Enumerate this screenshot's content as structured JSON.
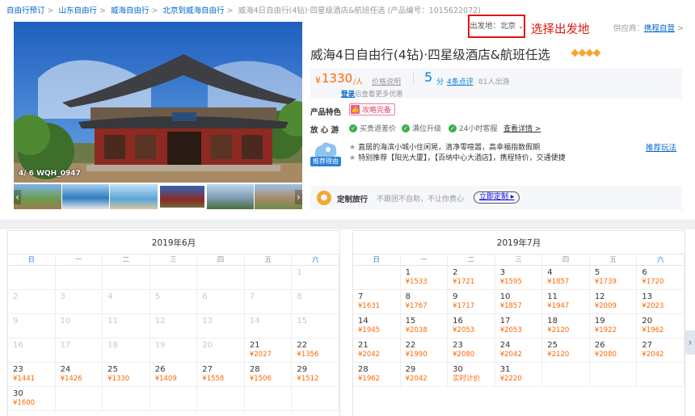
{
  "breadcrumb": [
    "自由行预订",
    "山东自由行",
    "威海自由行",
    "北京到威海自由行",
    "威海4日自由行(4钻)·四星级酒店&航班任选 (产品编号：1015622072)"
  ],
  "gallery": {
    "counter": "4/ 6 WQH_0947"
  },
  "depart": {
    "label": "出发地：北京"
  },
  "annotation": "选择出发地",
  "supplier": {
    "prefix": "供应商：",
    "name": "携程自营"
  },
  "product": {
    "title": "威海4日自由行(4钻)·四星级酒店&航班任选"
  },
  "price": {
    "currency": "¥",
    "value": "1330",
    "unit": "/人",
    "explain": "价格说明",
    "score": "5",
    "score_unit": "分",
    "reviews": "4条点评",
    "trips": "81人出游",
    "login": "登录",
    "login_hint": "后查看更多优惠"
  },
  "feature": {
    "label": "产品特色",
    "tag": "攻略完备"
  },
  "assurance": {
    "label": "放 心 游",
    "items": [
      "买贵退差价",
      "满位升级",
      "24小时客服"
    ],
    "more": "查看详情"
  },
  "reason": {
    "badge": "推荐理由",
    "lines": [
      "直居的海滨小城小住闲晃，清净零喧嚣，高幸福指数假期",
      "特别推荐【阳光大厦】，【百纳中心大酒店】，携程特价，交通便捷"
    ],
    "link": "推荐玩法"
  },
  "custom": {
    "title": "定制旅行",
    "desc": "不跟团不自助，不让你费心",
    "button": "立即定制"
  },
  "calendar": {
    "weekdays": [
      "日",
      "一",
      "二",
      "三",
      "四",
      "五",
      "六"
    ],
    "months": [
      {
        "title": "2019年6月",
        "cells": [
          {
            "d": ""
          },
          {
            "d": ""
          },
          {
            "d": ""
          },
          {
            "d": ""
          },
          {
            "d": ""
          },
          {
            "d": ""
          },
          {
            "d": "1",
            "dis": true
          },
          {
            "d": "2",
            "dis": true
          },
          {
            "d": "3",
            "dis": true
          },
          {
            "d": "4",
            "dis": true
          },
          {
            "d": "5",
            "dis": true
          },
          {
            "d": "6",
            "dis": true
          },
          {
            "d": "7",
            "dis": true
          },
          {
            "d": "8",
            "dis": true
          },
          {
            "d": "9",
            "dis": true
          },
          {
            "d": "10",
            "dis": true
          },
          {
            "d": "11",
            "dis": true
          },
          {
            "d": "12",
            "dis": true
          },
          {
            "d": "13",
            "dis": true
          },
          {
            "d": "14",
            "dis": true
          },
          {
            "d": "15",
            "dis": true
          },
          {
            "d": "16",
            "dis": true
          },
          {
            "d": "17",
            "dis": true
          },
          {
            "d": "18",
            "dis": true
          },
          {
            "d": "19",
            "dis": true
          },
          {
            "d": "20",
            "dis": true
          },
          {
            "d": "21",
            "p": "¥2027"
          },
          {
            "d": "22",
            "p": "¥1356"
          },
          {
            "d": "23",
            "p": "¥1441"
          },
          {
            "d": "24",
            "p": "¥1426"
          },
          {
            "d": "25",
            "p": "¥1330"
          },
          {
            "d": "26",
            "p": "¥1409"
          },
          {
            "d": "27",
            "p": "¥1558"
          },
          {
            "d": "28",
            "p": "¥1506"
          },
          {
            "d": "29",
            "p": "¥1512"
          },
          {
            "d": "30",
            "p": "¥1600"
          },
          {
            "d": ""
          },
          {
            "d": ""
          },
          {
            "d": ""
          },
          {
            "d": ""
          },
          {
            "d": ""
          },
          {
            "d": ""
          }
        ]
      },
      {
        "title": "2019年7月",
        "cells": [
          {
            "d": ""
          },
          {
            "d": "1",
            "p": "¥1533"
          },
          {
            "d": "2",
            "p": "¥1721"
          },
          {
            "d": "3",
            "p": "¥1595"
          },
          {
            "d": "4",
            "p": "¥1857"
          },
          {
            "d": "5",
            "p": "¥1739"
          },
          {
            "d": "6",
            "p": "¥1720"
          },
          {
            "d": "7",
            "p": "¥1631"
          },
          {
            "d": "8",
            "p": "¥1767"
          },
          {
            "d": "9",
            "p": "¥1717"
          },
          {
            "d": "10",
            "p": "¥1857"
          },
          {
            "d": "11",
            "p": "¥1947"
          },
          {
            "d": "12",
            "p": "¥2009"
          },
          {
            "d": "13",
            "p": "¥2023"
          },
          {
            "d": "14",
            "p": "¥1945"
          },
          {
            "d": "15",
            "p": "¥2038"
          },
          {
            "d": "16",
            "p": "¥2053"
          },
          {
            "d": "17",
            "p": "¥2053"
          },
          {
            "d": "18",
            "p": "¥2120"
          },
          {
            "d": "19",
            "p": "¥1922"
          },
          {
            "d": "20",
            "p": "¥1962"
          },
          {
            "d": "21",
            "p": "¥2042"
          },
          {
            "d": "22",
            "p": "¥1990"
          },
          {
            "d": "23",
            "p": "¥2080"
          },
          {
            "d": "24",
            "p": "¥2042"
          },
          {
            "d": "25",
            "p": "¥2120"
          },
          {
            "d": "26",
            "p": "¥2080"
          },
          {
            "d": "27",
            "p": "¥2042"
          },
          {
            "d": "28",
            "p": "¥1962"
          },
          {
            "d": "29",
            "p": "¥2042"
          },
          {
            "d": "30",
            "p": "实时计价"
          },
          {
            "d": "31",
            "p": "¥2220"
          },
          {
            "d": ""
          },
          {
            "d": ""
          },
          {
            "d": ""
          }
        ]
      }
    ]
  }
}
